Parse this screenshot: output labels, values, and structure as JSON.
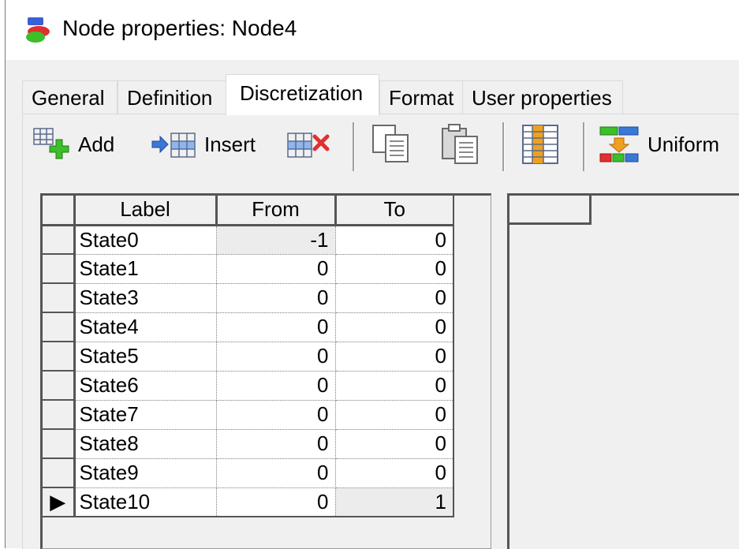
{
  "window": {
    "title": "Node properties: Node4"
  },
  "tabs": [
    {
      "label": "General"
    },
    {
      "label": "Definition"
    },
    {
      "label": "Discretization"
    },
    {
      "label": "Format"
    },
    {
      "label": "User properties"
    }
  ],
  "active_tab": "Discretization",
  "toolbar": {
    "add_label": "Add",
    "insert_label": "Insert",
    "uniform_label": "Uniform"
  },
  "grid": {
    "columns": [
      "Label",
      "From",
      "To"
    ],
    "rows": [
      {
        "label": "State0",
        "from": "-1",
        "to": "0"
      },
      {
        "label": "State1",
        "from": "0",
        "to": "0"
      },
      {
        "label": "State3",
        "from": "0",
        "to": "0"
      },
      {
        "label": "State4",
        "from": "0",
        "to": "0"
      },
      {
        "label": "State5",
        "from": "0",
        "to": "0"
      },
      {
        "label": "State6",
        "from": "0",
        "to": "0"
      },
      {
        "label": "State7",
        "from": "0",
        "to": "0"
      },
      {
        "label": "State8",
        "from": "0",
        "to": "0"
      },
      {
        "label": "State9",
        "from": "0",
        "to": "0"
      },
      {
        "label": "State10",
        "from": "0",
        "to": "1"
      }
    ],
    "current_row_marker": "▶"
  },
  "colors": {
    "dialog_bg": "#f0f0f0",
    "grid_line": "#555555",
    "icon_blue": "#3a78d6",
    "icon_green": "#3cbf2a",
    "icon_red": "#e03030",
    "icon_orange": "#f0a020"
  }
}
